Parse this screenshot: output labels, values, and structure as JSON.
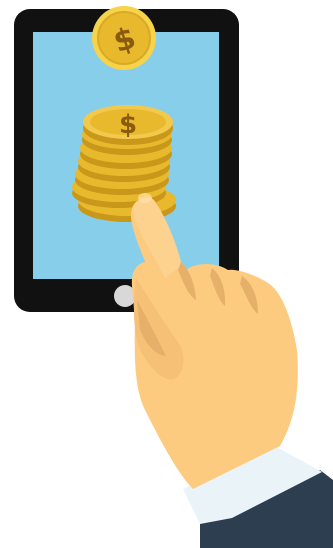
{
  "scene": {
    "tablet": {
      "frame_color": "#111111",
      "screen_color": "#87CEEB",
      "home_button_color": "#D8D8D8",
      "home_button_icon": "home-button-icon"
    },
    "coins": {
      "color": "#E8B92C",
      "edge_color": "#C9971A",
      "symbol": "$",
      "stack_count": 1,
      "floating_count": 1
    },
    "hand": {
      "skin_color": "#FCCB80",
      "shadow_color": "#E7B06A",
      "cuff_color": "#EAF3F8",
      "sleeve_color": "#2C3E50",
      "gesture": "pointing-tap"
    }
  }
}
